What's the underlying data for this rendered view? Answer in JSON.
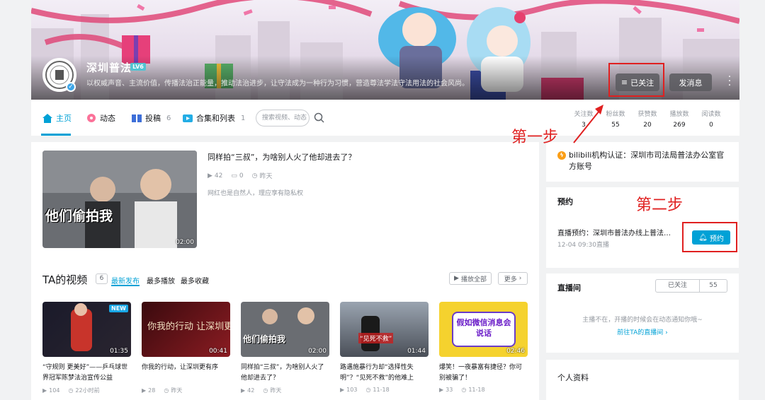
{
  "profile": {
    "name": "深圳普法",
    "level": "LV6",
    "sign": "以权威声音、主流价值，传播法治正能量，推动法治进步，让守法成为一种行为习惯，营造尊法学法守法用法的社会风尚。",
    "follow_button": "已关注",
    "message_button": "发消息"
  },
  "nav": {
    "tabs": [
      {
        "label": "主页",
        "count": ""
      },
      {
        "label": "动态",
        "count": ""
      },
      {
        "label": "投稿",
        "count": "6"
      },
      {
        "label": "合集和列表",
        "count": "1"
      }
    ],
    "search_placeholder": "搜索视频、动态"
  },
  "stats": [
    {
      "label": "关注数",
      "value": "3"
    },
    {
      "label": "粉丝数",
      "value": "55"
    },
    {
      "label": "获赞数",
      "value": "20"
    },
    {
      "label": "播放数",
      "value": "269"
    },
    {
      "label": "阅读数",
      "value": "0"
    }
  ],
  "featured": {
    "title": "同样拍“三叔”，为啥别人火了他却进去了？",
    "plays": "42",
    "comments": "0",
    "date": "昨天",
    "desc": "网红也是自然人，理应享有隐私权",
    "duration": "02:00",
    "thumb_caption": "他们偷拍我"
  },
  "videos_section": {
    "title": "TA的视频",
    "count": "6",
    "sorts": [
      "最新发布",
      "最多播放",
      "最多收藏"
    ],
    "play_all": "播放全部",
    "more": "更多"
  },
  "videos": [
    {
      "title": "“守规则 更美好”——乒乓球世界冠军陈梦法治宣传公益",
      "plays": "104",
      "date": "22小时前",
      "duration": "01:35",
      "badge": "NEW",
      "caption": ""
    },
    {
      "title": "你我的行动，让深圳更有序",
      "plays": "28",
      "date": "昨天",
      "duration": "00:41",
      "badge": "",
      "caption": "你我的行动 让深圳更有序"
    },
    {
      "title": "同样拍“三叔”，为啥别人火了他却进去了？",
      "plays": "42",
      "date": "昨天",
      "duration": "02:00",
      "badge": "",
      "caption": "他们偷拍我"
    },
    {
      "title": "路遇施暴行为却“选择性失明”？“见死不救”的他难上",
      "plays": "103",
      "date": "11-18",
      "duration": "01:44",
      "badge": "",
      "caption": "“见死不救”"
    },
    {
      "title": "爆笑！一夜暴富有捷径？你可别被骗了！",
      "plays": "33",
      "date": "11-18",
      "duration": "02:46",
      "badge": "",
      "caption": "假如微信消息会说话"
    }
  ],
  "certification": {
    "text": "bilibili机构认证：深圳市司法局普法办公室官方账号"
  },
  "reservation": {
    "title": "预约",
    "live_title": "直播预约：深圳市普法办线上普法活...",
    "time": "12-04 09:30直播",
    "button": "预约"
  },
  "live_room": {
    "title": "直播间",
    "followed": "已关注",
    "count": "55",
    "note": "主播不在，开播的时候会在动态通知你哦~",
    "link": "前往TA的直播间"
  },
  "personal": {
    "title": "个人资料"
  },
  "annotations": {
    "step1": "第一步",
    "step2": "第二步"
  },
  "colors": {
    "accent": "#00a1d6",
    "highlight": "#e02020"
  }
}
